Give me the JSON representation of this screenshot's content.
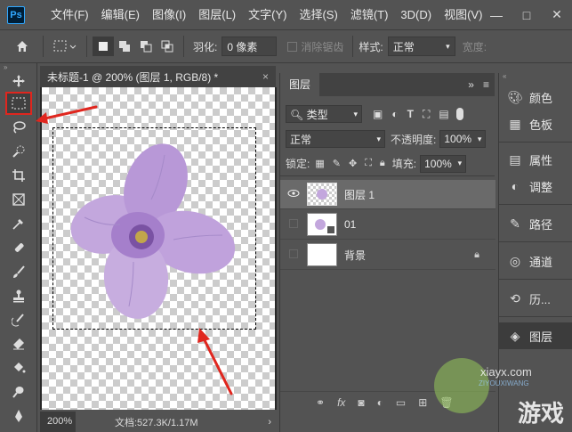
{
  "app": {
    "logo": "Ps"
  },
  "menu": [
    "文件(F)",
    "编辑(E)",
    "图像(I)",
    "图层(L)",
    "文字(Y)",
    "选择(S)",
    "滤镜(T)",
    "3D(D)",
    "视图(V)"
  ],
  "window_controls": {
    "minimize": "—",
    "maximize": "□",
    "close": "✕"
  },
  "options": {
    "feather_label": "羽化:",
    "feather_value": "0 像素",
    "antialias_label": "消除锯齿",
    "style_label": "样式:",
    "style_value": "正常",
    "width_label": "宽度:"
  },
  "document": {
    "tab_title": "未标题-1 @ 200% (图层 1, RGB/8) *",
    "tab_close": "×",
    "zoom": "200%",
    "doc_info": "文档:527.3K/1.17M",
    "status_arrow": "›"
  },
  "layers_panel": {
    "tab": "图层",
    "filter_kind": "类型",
    "blend_mode": "正常",
    "opacity_label": "不透明度:",
    "opacity_value": "100%",
    "lock_label": "锁定:",
    "fill_label": "填充:",
    "fill_value": "100%",
    "layers": [
      {
        "name": "图层 1",
        "visible": true,
        "selected": true
      },
      {
        "name": "01",
        "visible": false,
        "selected": false
      },
      {
        "name": "背景",
        "visible": false,
        "selected": false,
        "locked": true
      }
    ]
  },
  "dock": [
    {
      "icon": "color-icon",
      "label": "颜色"
    },
    {
      "icon": "swatches-icon",
      "label": "色板"
    },
    {
      "icon": "properties-icon",
      "label": "属性"
    },
    {
      "icon": "adjustments-icon",
      "label": "调整"
    },
    {
      "icon": "paths-icon",
      "label": "路径"
    },
    {
      "icon": "channels-icon",
      "label": "通道"
    },
    {
      "icon": "history-icon",
      "label": "历..."
    },
    {
      "icon": "layers-icon",
      "label": "图层"
    }
  ],
  "watermark": {
    "text": "游戏",
    "subtext": "ZIYOUXIWANG",
    "url": "xiayx.com"
  },
  "colors": {
    "highlight_red": "#e0261e",
    "flower": "#b99ad8"
  }
}
